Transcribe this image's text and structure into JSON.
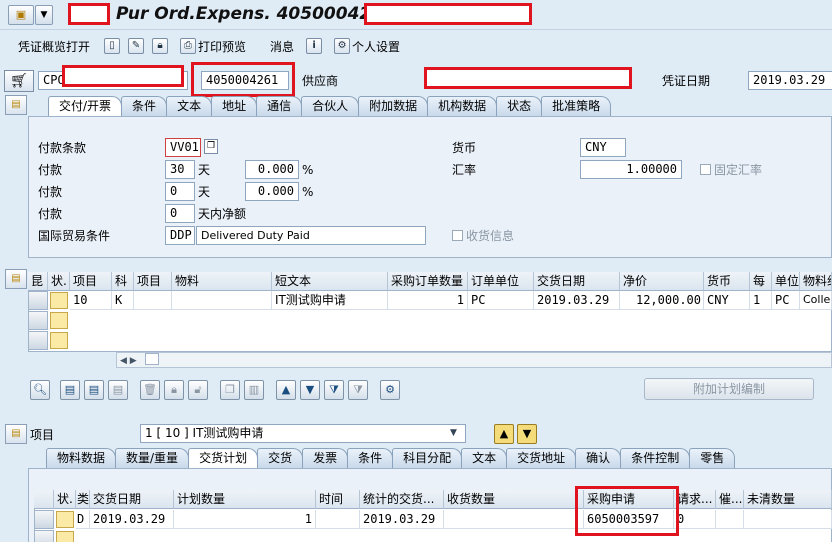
{
  "window": {
    "title": "Pur Ord.Expens. 4050004261"
  },
  "toolbar": {
    "items": [
      "凭证概览打开",
      "打印预览",
      "消息",
      "个人设置"
    ]
  },
  "header": {
    "doc_type": "CPO",
    "po_number": "4050004261",
    "vendor_label": "供应商",
    "doc_date_label": "凭证日期",
    "doc_date": "2019.03.29"
  },
  "header_tabs": [
    "交付/开票",
    "条件",
    "文本",
    "地址",
    "通信",
    "合伙人",
    "附加数据",
    "机构数据",
    "状态",
    "批准策略"
  ],
  "delivery": {
    "payment_terms_label": "付款条款",
    "payment_terms": "VV01",
    "pay_label": "付款",
    "days_1": "30",
    "days_2": "0",
    "days_3": "0",
    "days_unit": "天",
    "pct_1": "0.000",
    "pct_2": "0.000",
    "pct_unit": "%",
    "net_label": "天内净额",
    "incoterms_label": "国际贸易条件",
    "incoterms_code": "DDP",
    "incoterms_text": "Delivered Duty Paid",
    "currency_label": "货币",
    "currency": "CNY",
    "rate_label": "汇率",
    "rate": "1.00000",
    "fixed_rate_label": "固定汇率",
    "gr_message_label": "收货信息"
  },
  "items_grid": {
    "headers": [
      "昆",
      "状.",
      "项目",
      "科",
      "项目",
      "物料",
      "短文本",
      "采购订单数量",
      "订单单位",
      "交货日期",
      "净价",
      "货币",
      "每",
      "单位",
      "物料组"
    ],
    "row": [
      "",
      "",
      "10",
      "K",
      "",
      "",
      "IT测试购申请",
      "1",
      "PC",
      "2019.03.29",
      "12,000.00",
      "CNY",
      "1",
      "PC",
      "Collec"
    ]
  },
  "additional_button": "附加计划编制",
  "item_detail": {
    "label": "项目",
    "selected": "1 [ 10 ] IT测试购申请"
  },
  "item_tabs": [
    "物料数据",
    "数量/重量",
    "交货计划",
    "交货",
    "发票",
    "条件",
    "科目分配",
    "文本",
    "交货地址",
    "确认",
    "条件控制",
    "零售"
  ],
  "schedule_grid": {
    "headers": [
      "状.",
      "类",
      "交货日期",
      "计划数量",
      "时间",
      "统计的交货...",
      "收货数量",
      "采购申请",
      "请求...",
      "催...",
      "未清数量"
    ],
    "row": [
      "",
      "D",
      "2019.03.29",
      "1",
      "",
      "2019.03.29",
      "",
      "6050003597",
      "0",
      "",
      ""
    ]
  }
}
